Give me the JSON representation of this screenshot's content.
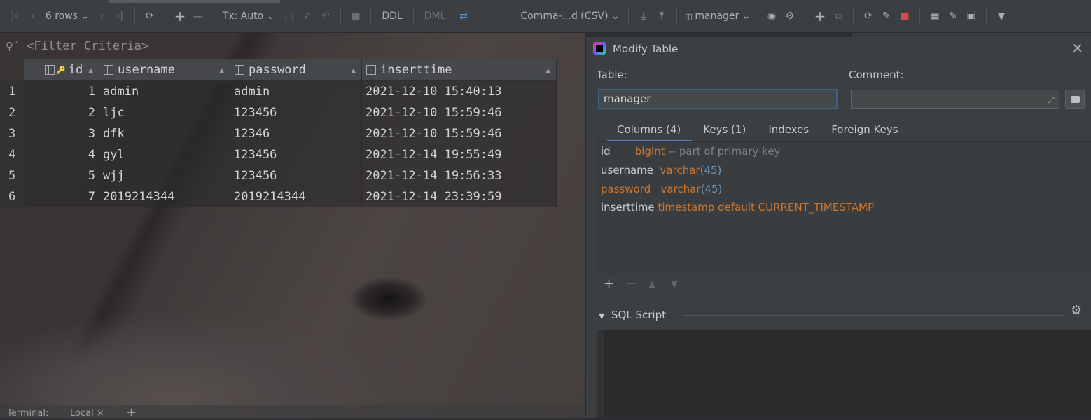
{
  "toolbar": {
    "rows_label": "6 rows",
    "tx_label": "Tx: Auto",
    "ddl_label": "DDL",
    "dml_label": "DML",
    "format_label": "Comma-...d (CSV)",
    "schema_label": "manager"
  },
  "filter": {
    "placeholder": "<Filter Criteria>"
  },
  "grid": {
    "columns": [
      "id",
      "username",
      "password",
      "inserttime"
    ],
    "rows": [
      {
        "rownum": "1",
        "id": "1",
        "username": "admin",
        "password": "admin",
        "inserttime": "2021-12-10 15:40:13"
      },
      {
        "rownum": "2",
        "id": "2",
        "username": "ljc",
        "password": "123456",
        "inserttime": "2021-12-10 15:59:46"
      },
      {
        "rownum": "3",
        "id": "3",
        "username": "dfk",
        "password": "12346",
        "inserttime": "2021-12-10 15:59:46"
      },
      {
        "rownum": "4",
        "id": "4",
        "username": "gyl",
        "password": "123456",
        "inserttime": "2021-12-14 19:55:49"
      },
      {
        "rownum": "5",
        "id": "5",
        "username": "wjj",
        "password": "123456",
        "inserttime": "2021-12-14 19:56:33"
      },
      {
        "rownum": "6",
        "id": "7",
        "username": "2019214344",
        "password": "2019214344",
        "inserttime": "2021-12-14 23:39:59"
      }
    ]
  },
  "bottom": {
    "terminal_label": "Terminal:",
    "local_label": "Local"
  },
  "dialog": {
    "title": "Modify Table",
    "table_label": "Table:",
    "table_value": "manager",
    "comment_label": "Comment:",
    "tabs": [
      "Columns (4)",
      "Keys (1)",
      "Indexes",
      "Foreign Keys"
    ],
    "columns": [
      {
        "name": "id",
        "type": "bigint",
        "size": "",
        "extra": "-- part of primary key"
      },
      {
        "name": "username",
        "type": "varchar",
        "size": "45",
        "extra": ""
      },
      {
        "name": "password",
        "type": "varchar",
        "size": "45",
        "extra": ""
      },
      {
        "name": "inserttime",
        "type": "timestamp default CURRENT_TIMESTAMP",
        "size": "",
        "extra": ""
      }
    ],
    "sql_script_label": "SQL Script"
  }
}
